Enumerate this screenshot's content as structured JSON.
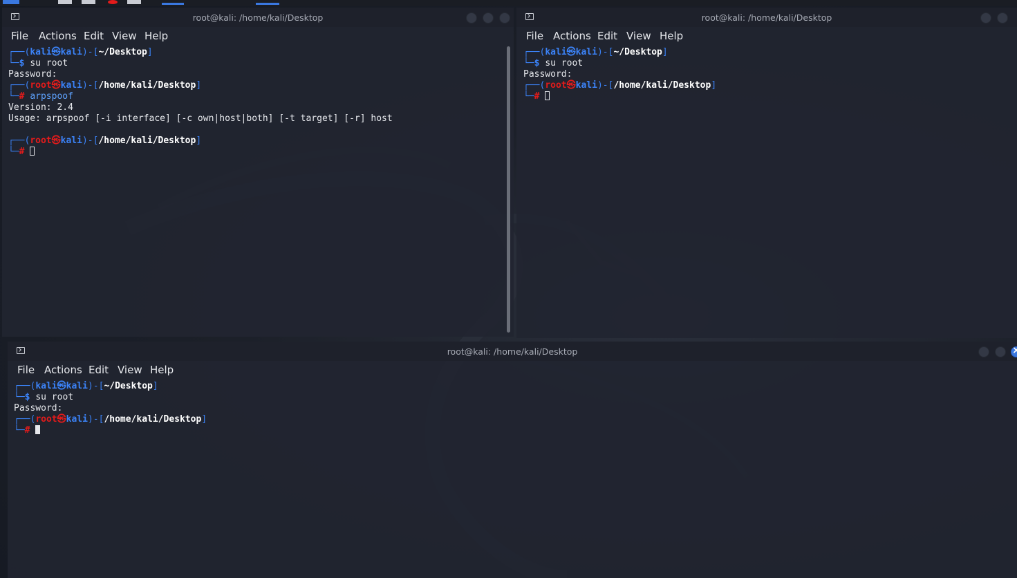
{
  "window_left": {
    "title": "root@kali: /home/kali/Desktop",
    "menu": [
      "File",
      "Actions",
      "Edit",
      "View",
      "Help"
    ],
    "lines": [
      {
        "kind": "prompt-user",
        "user": "kali",
        "host": "kali",
        "path": "~/Desktop"
      },
      {
        "kind": "cmd",
        "sym": "$",
        "cmd": "su root"
      },
      {
        "kind": "text",
        "text": "Password:"
      },
      {
        "kind": "prompt-root",
        "user": "root",
        "host": "kali",
        "path": "/home/kali/Desktop"
      },
      {
        "kind": "cmd",
        "sym": "#",
        "cmd": "arpspoof",
        "cmdcolor": "blue"
      },
      {
        "kind": "text",
        "text": "Version: 2.4"
      },
      {
        "kind": "text",
        "text": "Usage: arpspoof [-i interface] [-c own|host|both] [-t target] [-r] host"
      },
      {
        "kind": "text",
        "text": ""
      },
      {
        "kind": "prompt-root",
        "user": "root",
        "host": "kali",
        "path": "/home/kali/Desktop"
      },
      {
        "kind": "cursor",
        "sym": "#",
        "filled": false
      }
    ]
  },
  "window_right": {
    "title": "root@kali: /home/kali/Desktop",
    "menu": [
      "File",
      "Actions",
      "Edit",
      "View",
      "Help"
    ],
    "lines": [
      {
        "kind": "prompt-user",
        "user": "kali",
        "host": "kali",
        "path": "~/Desktop"
      },
      {
        "kind": "cmd",
        "sym": "$",
        "cmd": "su root"
      },
      {
        "kind": "text",
        "text": "Password:"
      },
      {
        "kind": "prompt-root",
        "user": "root",
        "host": "kali",
        "path": "/home/kali/Desktop"
      },
      {
        "kind": "cursor",
        "sym": "#",
        "filled": false
      }
    ]
  },
  "window_bottom": {
    "title": "root@kali: /home/kali/Desktop",
    "menu": [
      "File",
      "Actions",
      "Edit",
      "View",
      "Help"
    ],
    "lines": [
      {
        "kind": "prompt-user",
        "user": "kali",
        "host": "kali",
        "path": "~/Desktop"
      },
      {
        "kind": "cmd",
        "sym": "$",
        "cmd": "su root"
      },
      {
        "kind": "text",
        "text": "Password:"
      },
      {
        "kind": "prompt-root",
        "user": "root",
        "host": "kali",
        "path": "/home/kali/Desktop"
      },
      {
        "kind": "cursor",
        "sym": "#",
        "filled": true
      }
    ]
  },
  "colors": {
    "prompt_blue": "#3b82f6",
    "prompt_red": "#e31b1b",
    "accent": "#3a78e0"
  }
}
